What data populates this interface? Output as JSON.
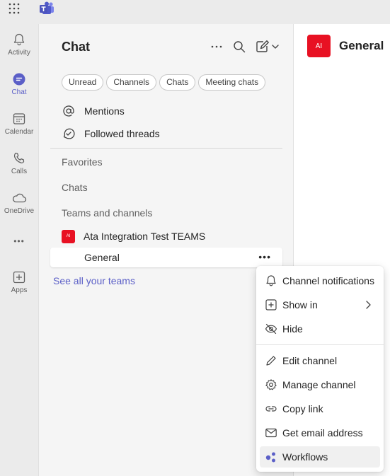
{
  "icons": {
    "apps": "grid-icon",
    "teams": "teams-logo-icon",
    "more": "more-horizontal-icon",
    "search": "search-icon",
    "compose": "compose-icon",
    "chevron_down": "chevron-down-icon"
  },
  "colors": {
    "accent": "#5b5fc7",
    "team_red": "#e81123",
    "rail_bg": "#ebebeb",
    "panel_bg": "#f5f5f5"
  },
  "rail": {
    "activity": "Activity",
    "chat": "Chat",
    "calendar": "Calendar",
    "calls": "Calls",
    "onedrive": "OneDrive",
    "more": "•••",
    "apps": "Apps"
  },
  "panel": {
    "title": "Chat",
    "filters": [
      "Unread",
      "Channels",
      "Chats",
      "Meeting chats"
    ],
    "mentions": "Mentions",
    "followed": "Followed threads",
    "favorites": "Favorites",
    "chats": "Chats",
    "teams_channels": "Teams and channels",
    "team_name": "Ata Integration Test TEAMS",
    "team_initials": "AI",
    "channel_name": "General",
    "channel_more": "•••",
    "see_all": "See all your teams"
  },
  "main": {
    "avatar_initials": "AI",
    "title": "General"
  },
  "menu": {
    "items": [
      "Channel notifications",
      "Show in",
      "Hide",
      "Edit channel",
      "Manage channel",
      "Copy link",
      "Get email address",
      "Workflows"
    ],
    "hovered": "Workflows"
  }
}
